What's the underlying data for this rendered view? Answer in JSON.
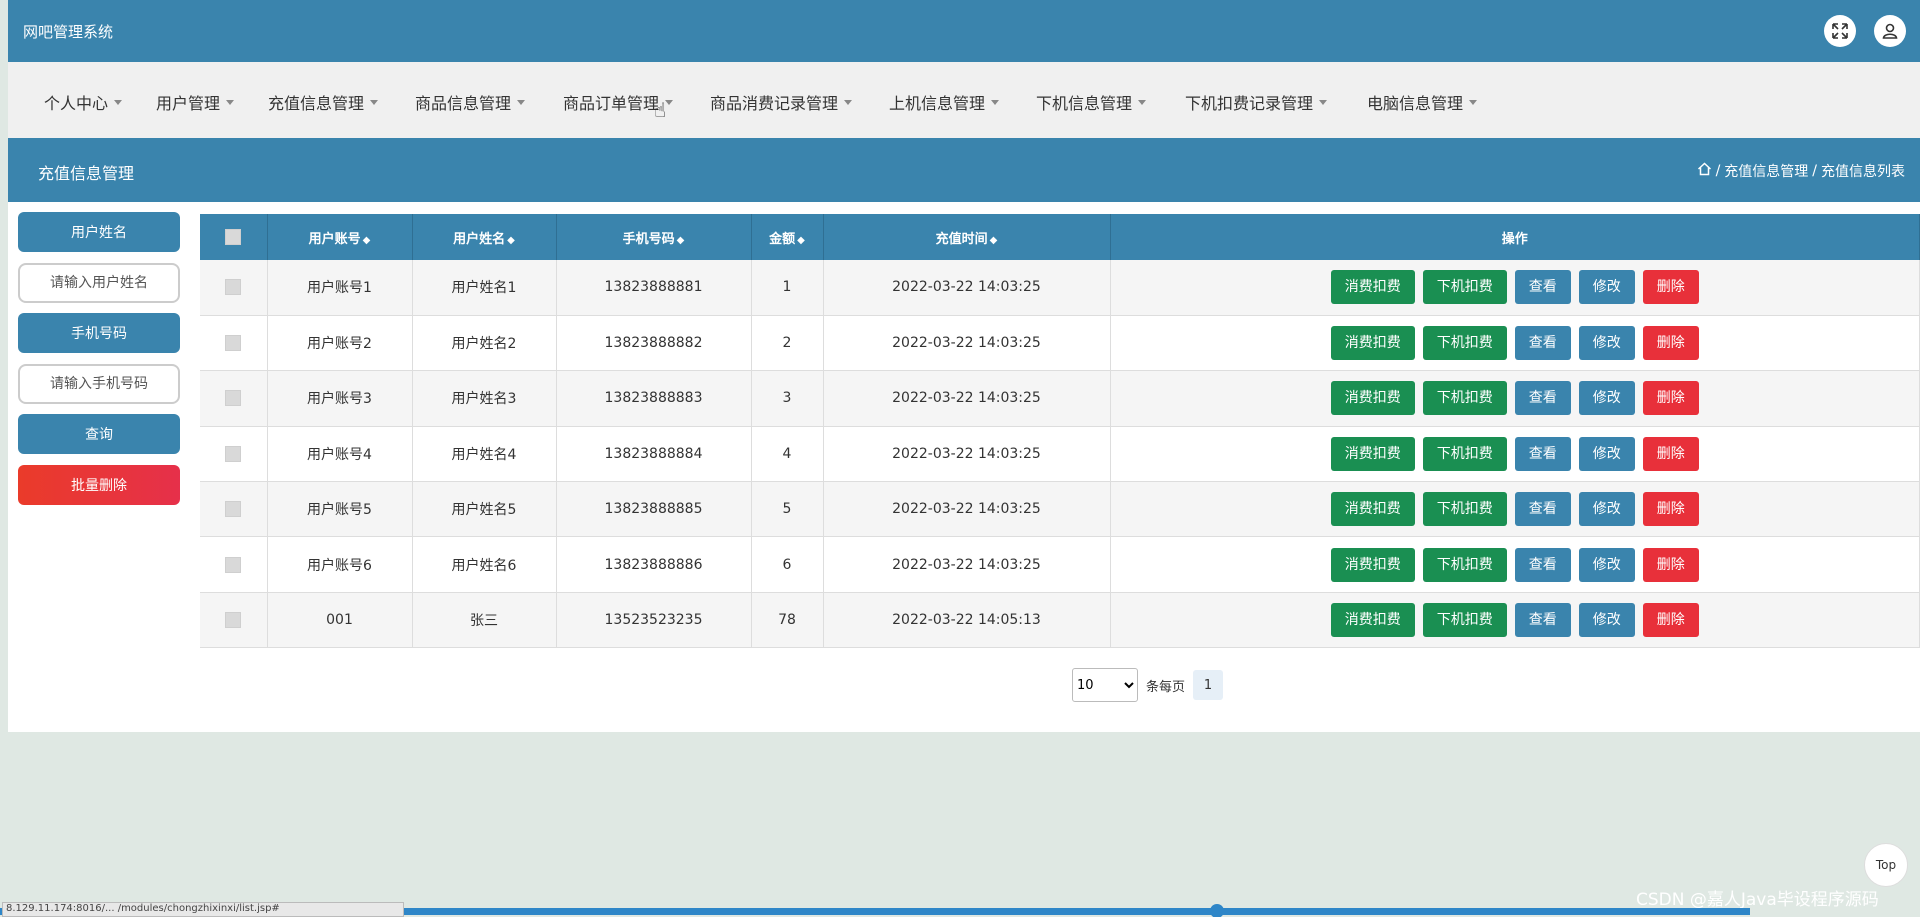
{
  "app": {
    "title": "网吧管理系统"
  },
  "topbar": {
    "fullscreen_icon": "expand-icon",
    "user_icon": "user-icon"
  },
  "nav": {
    "items": [
      {
        "label": "个人中心"
      },
      {
        "label": "用户管理"
      },
      {
        "label": "充值信息管理"
      },
      {
        "label": "商品信息管理"
      },
      {
        "label": "商品订单管理"
      },
      {
        "label": "商品消费记录管理"
      },
      {
        "label": "上机信息管理"
      },
      {
        "label": "下机信息管理"
      },
      {
        "label": "下机扣费记录管理"
      },
      {
        "label": "电脑信息管理"
      }
    ]
  },
  "page": {
    "title": "充值信息管理",
    "breadcrumb": {
      "home_icon": "home-icon",
      "level1": "充值信息管理",
      "level2": "充值信息列表",
      "sep": "/"
    }
  },
  "search": {
    "name_label": "用户姓名",
    "name_placeholder": "请输入用户姓名",
    "phone_label": "手机号码",
    "phone_placeholder": "请输入手机号码",
    "query_button": "查询",
    "batch_delete_button": "批量删除"
  },
  "table": {
    "headers": [
      "用户账号",
      "用户姓名",
      "手机号码",
      "金额",
      "充值时间",
      "操作"
    ],
    "sort_glyph": "◆",
    "actions": [
      "消费扣费",
      "下机扣费",
      "查看",
      "修改",
      "删除"
    ],
    "rows": [
      {
        "account": "用户账号1",
        "name": "用户姓名1",
        "phone": "13823888881",
        "amount": "1",
        "time": "2022-03-22 14:03:25"
      },
      {
        "account": "用户账号2",
        "name": "用户姓名2",
        "phone": "13823888882",
        "amount": "2",
        "time": "2022-03-22 14:03:25"
      },
      {
        "account": "用户账号3",
        "name": "用户姓名3",
        "phone": "13823888883",
        "amount": "3",
        "time": "2022-03-22 14:03:25"
      },
      {
        "account": "用户账号4",
        "name": "用户姓名4",
        "phone": "13823888884",
        "amount": "4",
        "time": "2022-03-22 14:03:25"
      },
      {
        "account": "用户账号5",
        "name": "用户姓名5",
        "phone": "13823888885",
        "amount": "5",
        "time": "2022-03-22 14:03:25"
      },
      {
        "account": "用户账号6",
        "name": "用户姓名6",
        "phone": "13823888886",
        "amount": "6",
        "time": "2022-03-22 14:03:25"
      },
      {
        "account": "001",
        "name": "张三",
        "phone": "13523523235",
        "amount": "78",
        "time": "2022-03-22 14:05:13"
      }
    ]
  },
  "pager": {
    "page_size": "10",
    "per_page_label": "条每页",
    "current_page": "1"
  },
  "floating": {
    "top_button": "Top"
  },
  "watermark": "CSDN @嘉人Java毕设程序源码",
  "status_bar": {
    "url": "8.129.11.174:8016/... /modules/chongzhixinxi/list.jsp#"
  },
  "colors": {
    "primary": "#3a84ad",
    "green": "#1a8f52",
    "red": "#e8303a"
  }
}
